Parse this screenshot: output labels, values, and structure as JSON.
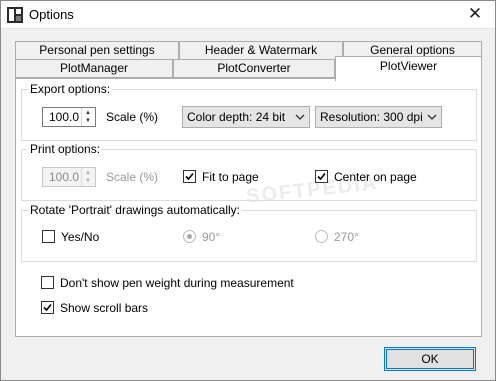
{
  "window": {
    "title": "Options",
    "close_label": "✕"
  },
  "tabs": {
    "row1": [
      "Personal pen settings",
      "Header & Watermark",
      "General options"
    ],
    "row2": [
      "PlotManager",
      "PlotConverter"
    ],
    "active": "PlotViewer"
  },
  "export_options": {
    "title": "Export options:",
    "scale_value": "100.0",
    "scale_label": "Scale (%)",
    "color_depth": "Color depth: 24 bit",
    "resolution": "Resolution: 300 dpi"
  },
  "print_options": {
    "title": "Print options:",
    "scale_value": "100.0",
    "scale_label": "Scale (%)",
    "fit_to_page": {
      "label": "Fit to page",
      "checked": true
    },
    "center_on_page": {
      "label": "Center on page",
      "checked": true
    }
  },
  "rotate": {
    "title": "Rotate 'Portrait' drawings automatically:",
    "yes_no": {
      "label": "Yes/No",
      "checked": false
    },
    "opt90": {
      "label": "90°",
      "selected": true
    },
    "opt270": {
      "label": "270°",
      "selected": false
    }
  },
  "misc": {
    "dont_show_pen_weight": {
      "label": "Don't show pen weight during measurement",
      "checked": false
    },
    "show_scroll_bars": {
      "label": "Show scroll bars",
      "checked": true
    }
  },
  "buttons": {
    "ok": "OK"
  },
  "watermark": "SOFTPEDIA"
}
